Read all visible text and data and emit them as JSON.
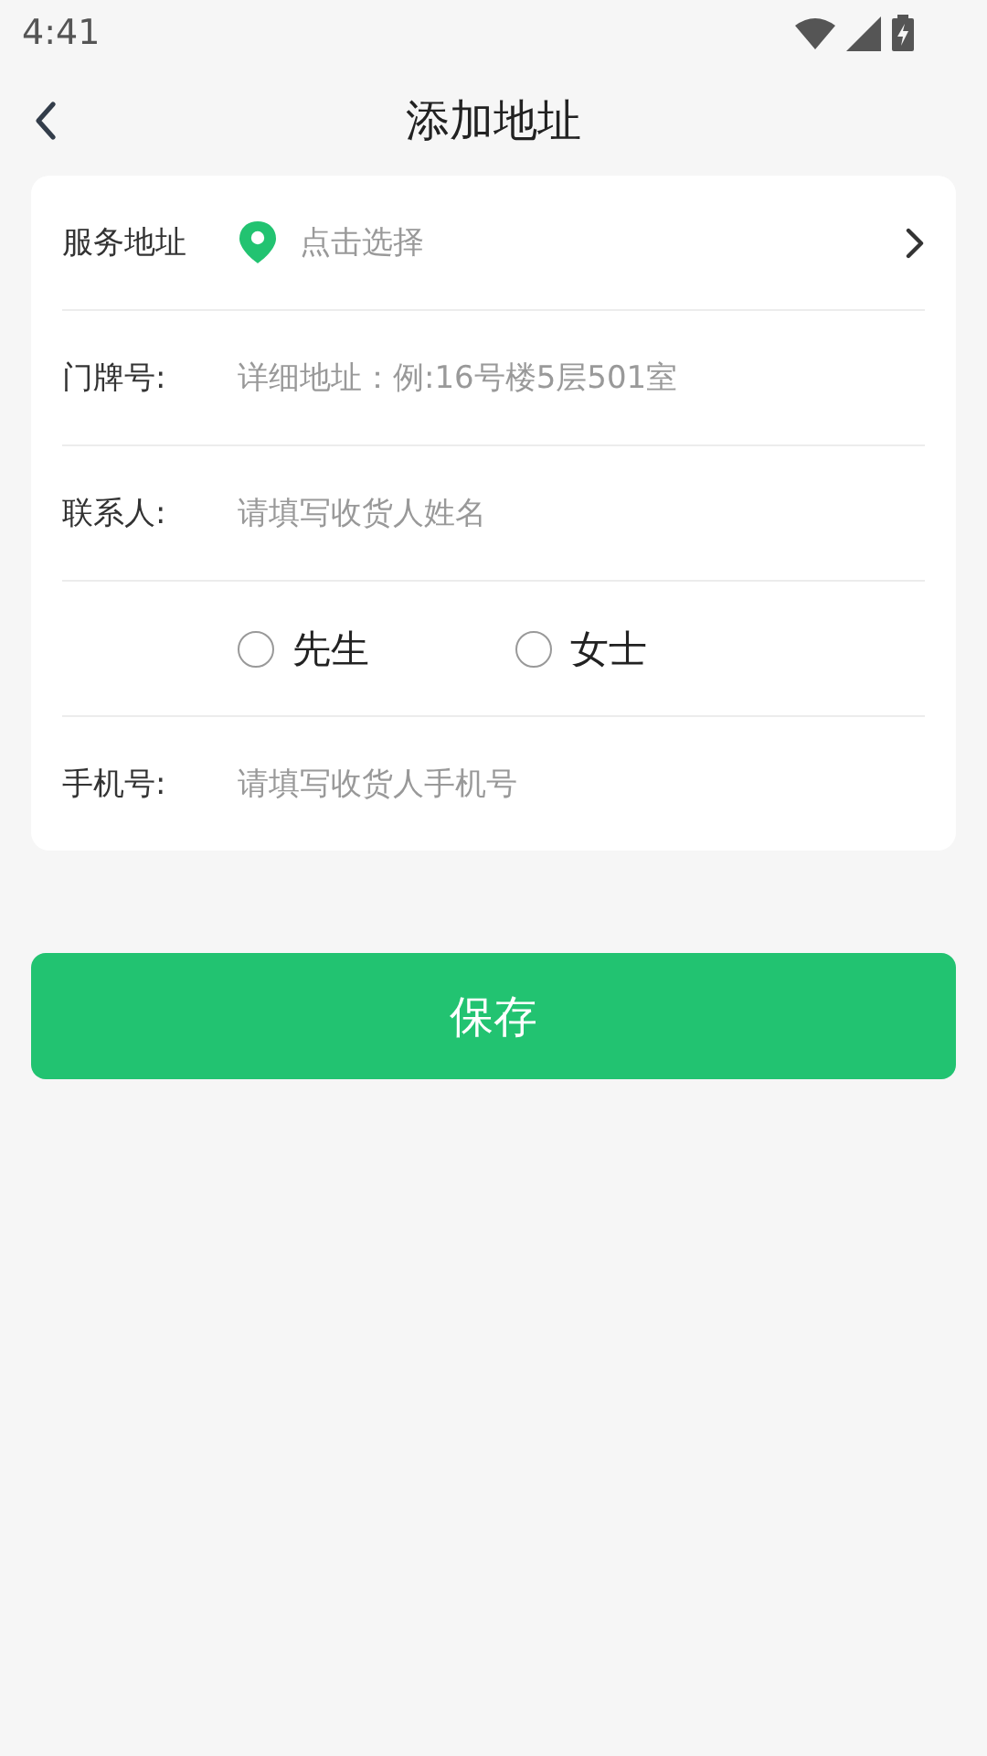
{
  "status_bar": {
    "time": "4:41"
  },
  "header": {
    "title": "添加地址"
  },
  "service_address": {
    "label": "服务地址",
    "placeholder": "点击选择"
  },
  "fields": [
    {
      "label": "门牌号:",
      "placeholder": "详细地址：例:16号楼5层501室"
    },
    {
      "label": "联系人:",
      "placeholder": "请填写收货人姓名"
    }
  ],
  "gender_options": [
    {
      "label": "先生",
      "selected": false
    },
    {
      "label": "女士",
      "selected": false
    }
  ],
  "phone": {
    "label": "手机号:",
    "placeholder": "请填写收货人手机号"
  },
  "save_button": {
    "label": "保存"
  }
}
